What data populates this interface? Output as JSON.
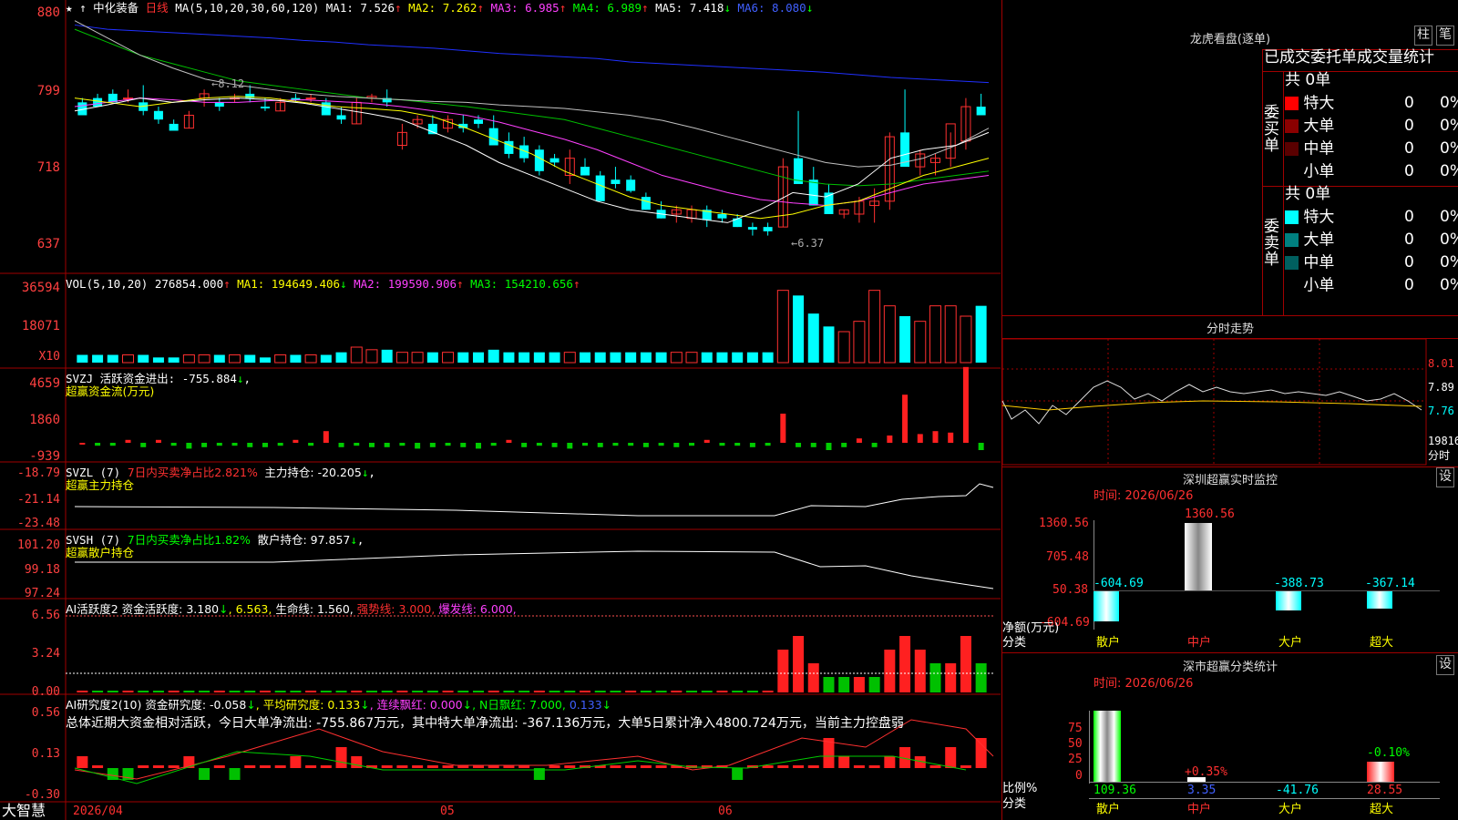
{
  "chart_data": {
    "type": "candlestick",
    "title": "中化装备 日线",
    "price": {
      "y_ticks": [
        "880",
        "799",
        "718",
        "637"
      ],
      "low_marker": "←6.37",
      "high_marker": "←8.12"
    },
    "candles": [
      [
        7.85,
        7.9,
        7.8,
        7.7
      ],
      [
        7.9,
        7.95,
        7.85,
        7.8
      ],
      [
        7.95,
        8.0,
        7.9,
        7.85
      ],
      [
        7.9,
        8.0,
        7.85,
        7.9
      ],
      [
        7.85,
        8.05,
        7.7,
        7.75
      ],
      [
        7.75,
        7.8,
        7.6,
        7.65
      ],
      [
        7.6,
        7.65,
        7.55,
        7.52
      ],
      [
        7.55,
        7.75,
        7.55,
        7.7
      ],
      [
        7.9,
        8.0,
        7.8,
        7.95
      ],
      [
        7.85,
        7.9,
        7.75,
        7.8
      ],
      [
        7.9,
        7.95,
        7.85,
        7.9
      ],
      [
        7.95,
        8.05,
        7.85,
        7.9
      ],
      [
        7.8,
        7.9,
        7.75,
        7.78
      ],
      [
        7.75,
        7.9,
        7.75,
        7.85
      ],
      [
        7.9,
        7.95,
        7.85,
        7.88
      ],
      [
        7.9,
        7.95,
        7.85,
        7.9
      ],
      [
        7.85,
        7.9,
        7.75,
        7.7
      ],
      [
        7.7,
        7.8,
        7.6,
        7.65
      ],
      [
        7.6,
        7.9,
        7.6,
        7.85
      ],
      [
        7.9,
        7.95,
        7.85,
        7.92
      ],
      [
        7.9,
        8.0,
        7.8,
        7.85
      ],
      [
        7.35,
        7.6,
        7.3,
        7.5
      ],
      [
        7.6,
        7.7,
        7.55,
        7.65
      ],
      [
        7.6,
        7.7,
        7.5,
        7.48
      ],
      [
        7.55,
        7.7,
        7.5,
        7.65
      ],
      [
        7.6,
        7.7,
        7.5,
        7.55
      ],
      [
        7.65,
        7.7,
        7.55,
        7.6
      ],
      [
        7.55,
        7.7,
        7.35,
        7.35
      ],
      [
        7.4,
        7.5,
        7.2,
        7.25
      ],
      [
        7.35,
        7.45,
        7.15,
        7.2
      ],
      [
        7.3,
        7.35,
        7.0,
        7.05
      ],
      [
        7.2,
        7.25,
        7.1,
        7.15
      ],
      [
        7.0,
        7.3,
        6.9,
        7.2
      ],
      [
        7.1,
        7.2,
        7.0,
        7.0
      ],
      [
        7.0,
        7.05,
        6.8,
        6.7
      ],
      [
        6.95,
        7.1,
        6.85,
        6.9
      ],
      [
        6.95,
        7.0,
        6.8,
        6.82
      ],
      [
        6.75,
        6.8,
        6.6,
        6.6
      ],
      [
        6.6,
        6.7,
        6.5,
        6.5
      ],
      [
        6.55,
        6.65,
        6.45,
        6.6
      ],
      [
        6.5,
        6.65,
        6.45,
        6.6
      ],
      [
        6.6,
        6.65,
        6.4,
        6.48
      ],
      [
        6.55,
        6.6,
        6.45,
        6.5
      ],
      [
        6.5,
        6.55,
        6.4,
        6.4
      ],
      [
        6.4,
        6.45,
        6.3,
        6.37
      ],
      [
        6.4,
        6.45,
        6.3,
        6.35
      ],
      [
        6.4,
        7.2,
        6.4,
        7.1
      ],
      [
        7.2,
        7.75,
        7.0,
        6.9
      ],
      [
        6.95,
        7.1,
        6.65,
        6.65
      ],
      [
        6.8,
        6.9,
        6.55,
        6.55
      ],
      [
        6.55,
        6.6,
        6.5,
        6.6
      ],
      [
        6.55,
        6.75,
        6.45,
        6.7
      ],
      [
        6.65,
        6.85,
        6.45,
        6.7
      ],
      [
        6.7,
        7.5,
        6.6,
        7.45
      ],
      [
        7.5,
        8.0,
        7.2,
        7.1
      ],
      [
        7.1,
        7.3,
        7.0,
        7.25
      ],
      [
        7.15,
        7.25,
        7.0,
        7.2
      ],
      [
        7.2,
        7.5,
        7.1,
        7.6
      ],
      [
        7.4,
        7.9,
        7.3,
        7.8
      ],
      [
        7.8,
        7.95,
        7.7,
        7.7
      ]
    ],
    "ma": {
      "MA1": "7.526",
      "MA2": "7.262",
      "MA3": "6.985",
      "MA4": "6.989",
      "MA5": "7.418",
      "MA6": "8.080"
    },
    "volume": {
      "y_ticks": [
        "36594",
        "18071"
      ],
      "x_unit": "X10",
      "values": [
        3,
        3,
        3,
        3,
        3,
        2,
        2,
        3,
        3,
        3,
        3,
        3,
        2,
        3,
        3,
        3,
        3,
        4,
        6,
        5,
        5,
        4,
        4,
        4,
        4,
        4,
        4,
        5,
        4,
        4,
        4,
        4,
        4,
        4,
        4,
        4,
        4,
        4,
        4,
        4,
        4,
        4,
        4,
        4,
        4,
        4,
        28,
        26,
        19,
        14,
        12,
        16,
        28,
        22,
        18,
        16,
        22,
        22,
        18,
        22
      ],
      "ma_values": {
        "MA1": "194649.406",
        "MA2": "199590.906",
        "MA3": "154210.656"
      },
      "current": "276854.000"
    },
    "svzj": {
      "y_ticks": [
        "4659",
        "1860",
        "-939"
      ],
      "value": "-755.884",
      "values": [
        0,
        -0.2,
        -0.2,
        0.2,
        -0.3,
        0.2,
        -0.2,
        -0.4,
        -0.3,
        -0.2,
        -0.2,
        -0.3,
        -0.3,
        -0.2,
        0.2,
        -0.2,
        0.8,
        -0.3,
        -0.2,
        -0.3,
        -0.3,
        -0.2,
        -0.4,
        -0.3,
        -0.2,
        -0.3,
        -0.4,
        -0.2,
        0.2,
        -0.3,
        -0.2,
        -0.3,
        -0.4,
        -0.2,
        -0.3,
        -0.2,
        -0.2,
        -0.3,
        -0.2,
        -0.3,
        -0.2,
        0.2,
        -0.2,
        -0.2,
        -0.3,
        -0.2,
        2.0,
        -0.3,
        -0.3,
        -0.5,
        -0.3,
        0.3,
        -0.3,
        0.5,
        3.3,
        0.6,
        0.8,
        0.7,
        5.2,
        -0.5
      ]
    }
  }
}
